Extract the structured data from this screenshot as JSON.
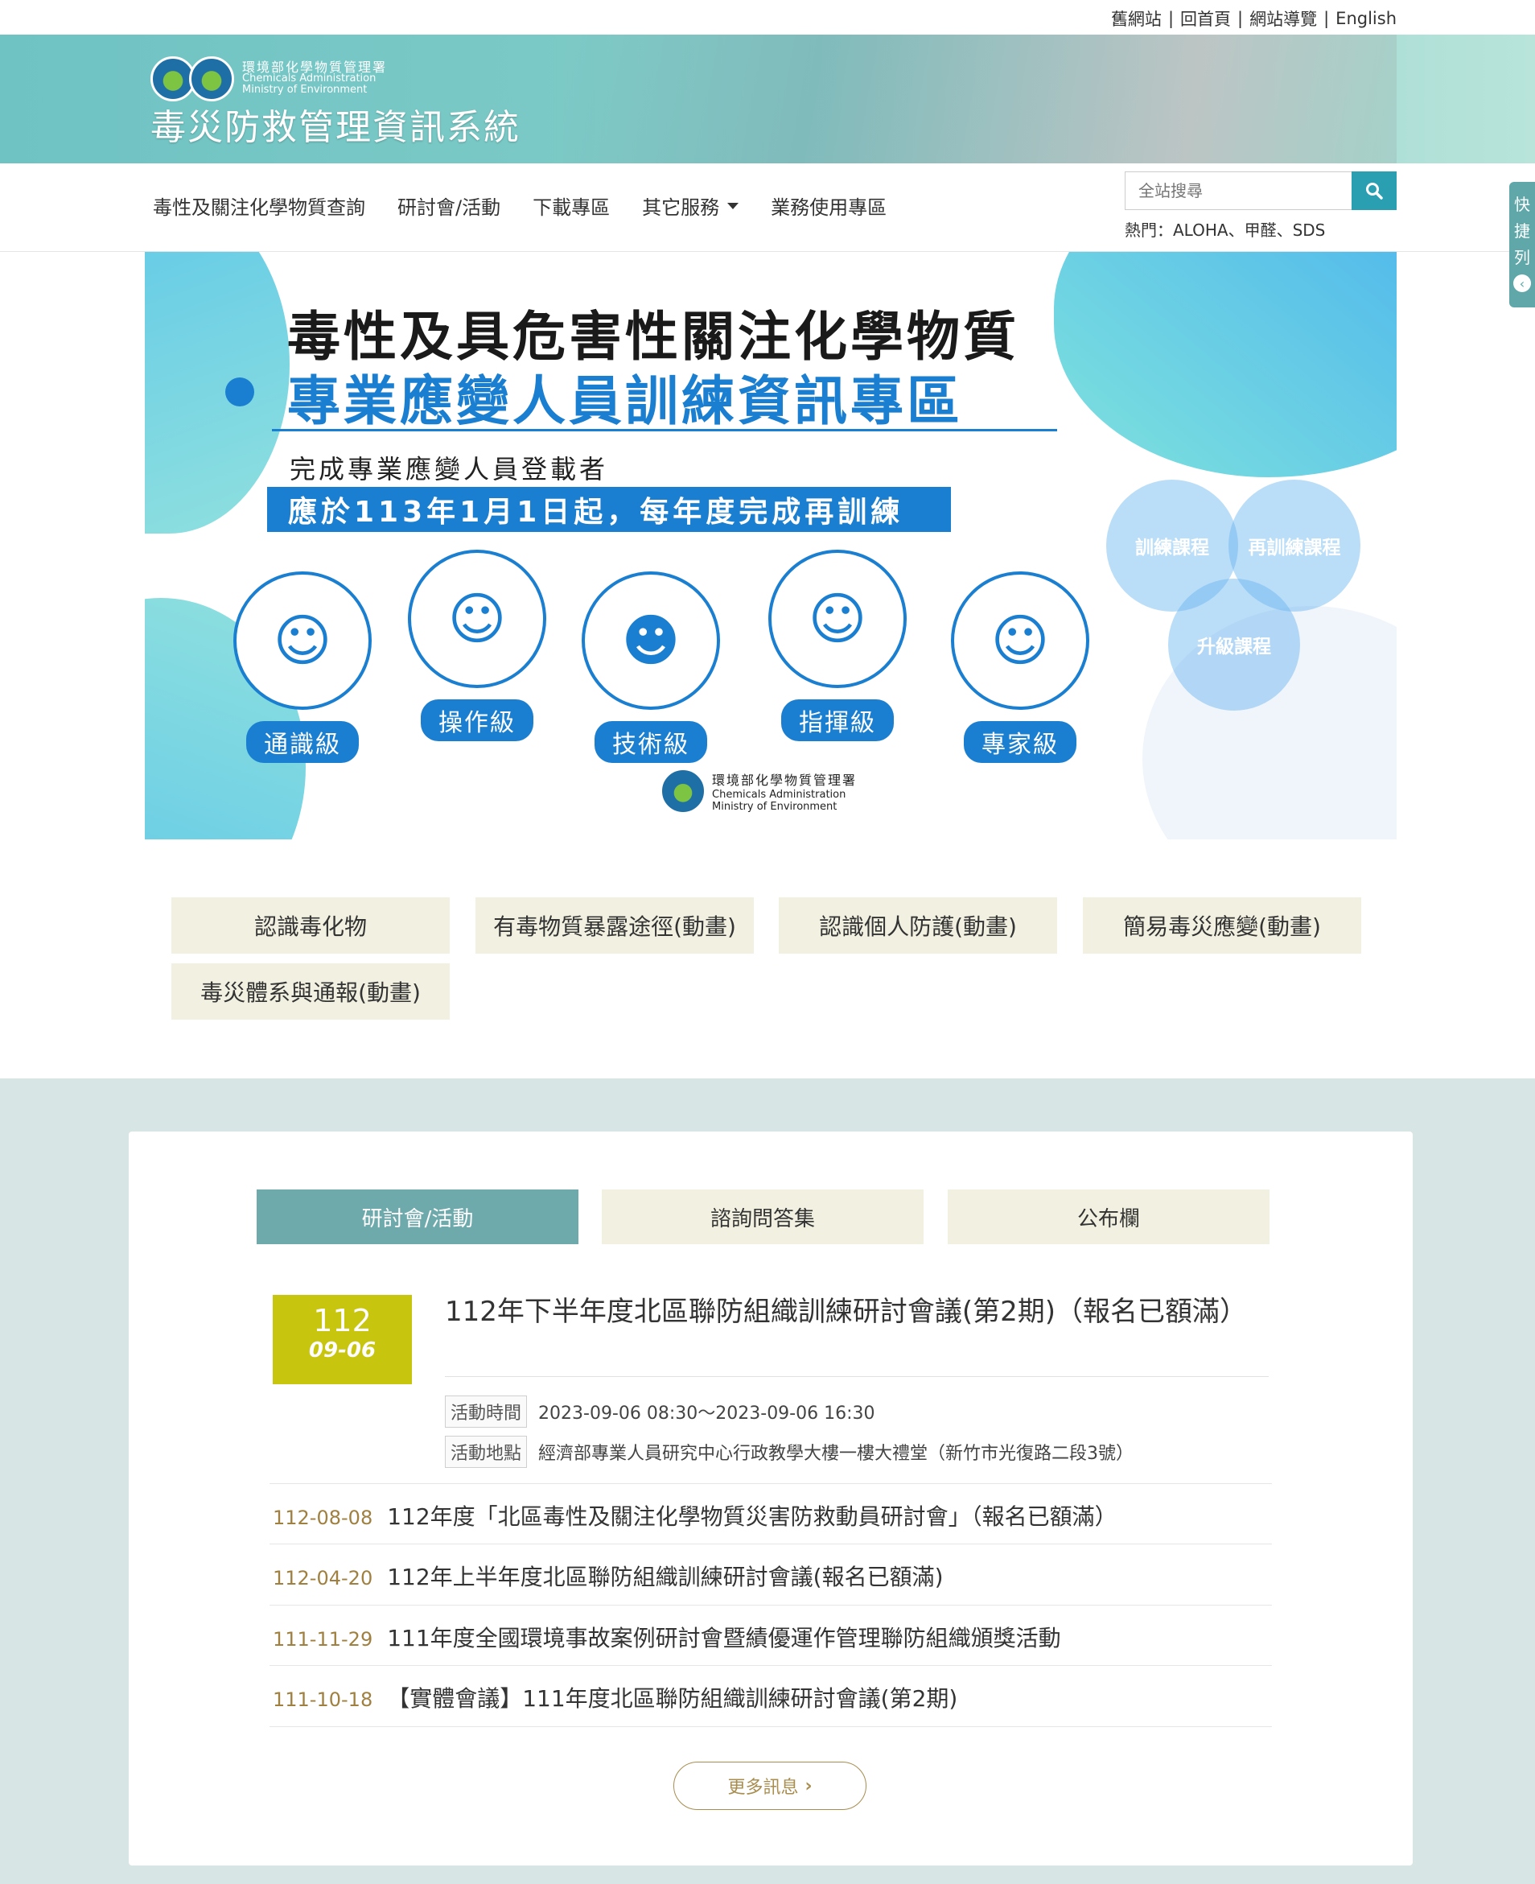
{
  "toplinks": [
    "舊網站",
    "回首頁",
    "網站導覽",
    "English"
  ],
  "header": {
    "org_cn": "環境部化學物質管理署",
    "org_en1": "Chemicals Administration",
    "org_en2": "Ministry of Environment",
    "site_title": "毒災防救管理資訊系統"
  },
  "nav": {
    "items": [
      "毒性及關注化學物質查詢",
      "研討會/活動",
      "下載專區",
      "其它服務",
      "業務使用專區"
    ],
    "search_placeholder": "全站搜尋",
    "hot": "熱門：ALOHA、甲醛、SDS"
  },
  "quickbar": {
    "label": [
      "快",
      "捷",
      "列"
    ]
  },
  "hero": {
    "line1": "毒性及具危害性關注化學物質",
    "line2": "專業應變人員訓練資訊專區",
    "sub": "完成專業應變人員登載者",
    "strip": "應於113年1月1日起，每年度完成再訓練",
    "levels": [
      "通識級",
      "操作級",
      "技術級",
      "指揮級",
      "專家級"
    ],
    "venn": [
      "訓練課程",
      "再訓練課程",
      "升級課程"
    ],
    "logo_cn": "環境部化學物質管理署",
    "logo_en1": "Chemicals Administration",
    "logo_en2": "Ministry of Environment"
  },
  "quick_buttons": [
    "認識毒化物",
    "有毒物質暴露途徑(動畫)",
    "認識個人防護(動畫)",
    "簡易毒災應變(動畫)",
    "毒災體系與通報(動畫)"
  ],
  "tabs": [
    "研討會/活動",
    "諮詢問答集",
    "公布欄"
  ],
  "featured": {
    "year": "112",
    "md": "09-06",
    "title": "112年下半年度北區聯防組織訓練研討會議(第2期)（報名已額滿）",
    "time_label": "活動時間",
    "time": "2023-09-06 08:30～2023-09-06 16:30",
    "place_label": "活動地點",
    "place": "經濟部專業人員研究中心行政教學大樓一樓大禮堂（新竹市光復路二段3號）"
  },
  "news": [
    {
      "date": "112-08-08",
      "title": "112年度「北區毒性及關注化學物質災害防救動員研討會」（報名已額滿）"
    },
    {
      "date": "112-04-20",
      "title": "112年上半年度北區聯防組織訓練研討會議(報名已額滿)"
    },
    {
      "date": "111-11-29",
      "title": "111年度全國環境事故案例研討會暨績優運作管理聯防組織頒獎活動"
    },
    {
      "date": "111-10-18",
      "title": "【實體會議】111年度北區聯防組織訓練研討會議(第2期)"
    }
  ],
  "more_label": "更多訊息",
  "colors": {
    "teal": "#6ea9ac",
    "blue": "#1a7fd0",
    "olive": "#c8c50e",
    "beige": "#f2f0e1",
    "bg": "#d7e5e5"
  }
}
